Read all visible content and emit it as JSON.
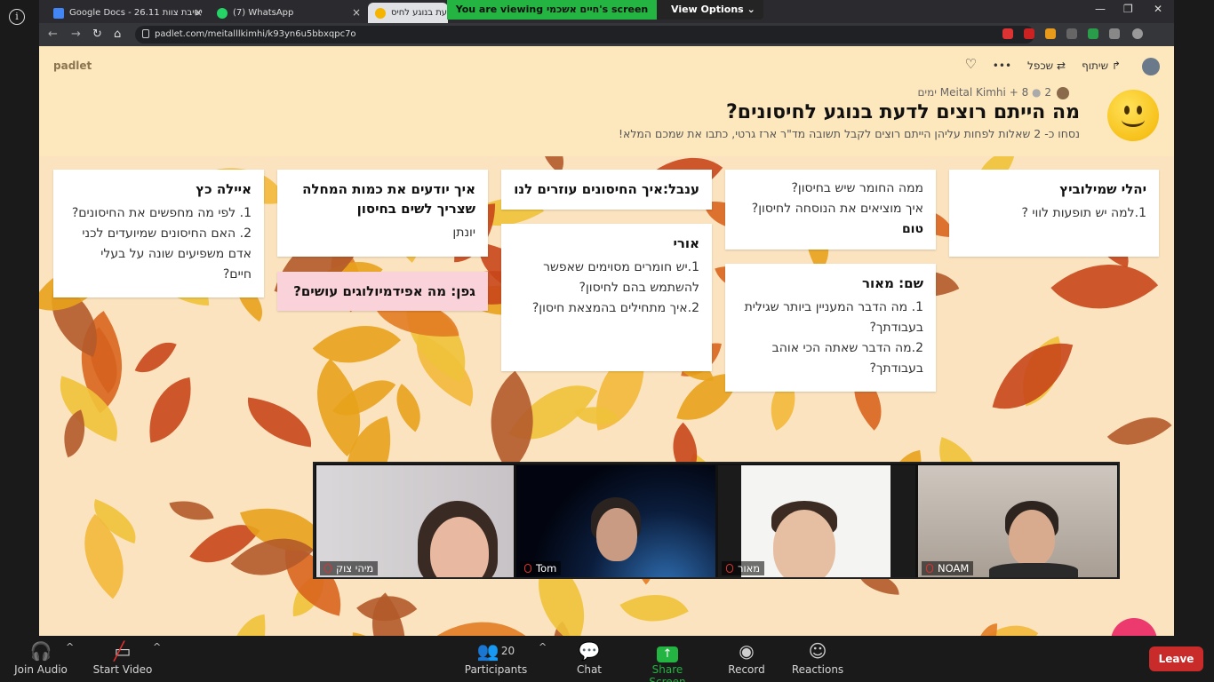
{
  "zoom": {
    "banner_text": "You are viewing חיים אשכמי's screen",
    "view_options": "View Options",
    "toolbar": [
      {
        "label": "Join Audio",
        "icon": "headphones-icon"
      },
      {
        "label": "Start Video",
        "icon": "video-off-icon"
      },
      {
        "label": "Participants",
        "icon": "participants-icon",
        "count": "20"
      },
      {
        "label": "Chat",
        "icon": "chat-icon"
      },
      {
        "label": "Share Screen",
        "icon": "share-screen-icon"
      },
      {
        "label": "Record",
        "icon": "record-icon"
      },
      {
        "label": "Reactions",
        "icon": "reactions-icon"
      }
    ],
    "leave": "Leave",
    "participants": [
      {
        "name": "מיהי צוק"
      },
      {
        "name": "Tom"
      },
      {
        "name": "מאור"
      },
      {
        "name": "NOAM"
      }
    ]
  },
  "browser": {
    "tabs": [
      {
        "title": "Google Docs - 26.11 ישיבת צוות",
        "fav_color": "#4285f4"
      },
      {
        "title": "(7) WhatsApp",
        "fav_color": "#25d366"
      },
      {
        "title": "מה הייתם רוצים לדעת בנוגע לחיס",
        "fav_color": "#f4b400"
      }
    ],
    "url": "padlet.com/meitalllkimhi/k93yn6u5bbxqpc7o",
    "tab_close": "×"
  },
  "padlet": {
    "logo": "padlet",
    "actions": {
      "share": "שיתוף",
      "remake": "שכפל",
      "more": "•••"
    },
    "meta": {
      "author": "Meital Kimhi",
      "plus_count": "+ 8",
      "age": "2 ימים"
    },
    "title": "מה הייתם רוצים לדעת בנוגע לחיסונים?",
    "description": "נסחו כ- 2 שאלות לפחות עליהן הייתם רוצים לקבל תשובה מד\"ר ארז גרטי, כתבו את שמכם המלא!",
    "posts": [
      {
        "title": "יהלי שמילוביץ",
        "lines": [
          "1.למה יש תופעות לווי ?"
        ]
      },
      {
        "title": "",
        "lines": [
          "ממה החומר שיש בחיסון?",
          "איך מוציאים את הנוסחה לחיסון?"
        ],
        "footer": "טום"
      },
      {
        "title": "שם: מאור",
        "lines": [
          "1. מה הדבר המעניין ביותר שגילית",
          "בעבודתך?",
          "2.מה הדבר שאתה הכי אוהב",
          "בעבודתך?"
        ]
      },
      {
        "title": "ענבל:איך החיסונים עוזרים לנו",
        "lines": []
      },
      {
        "title": "אורי",
        "lines": [
          "1.יש חומרים מסוימים שאפשר",
          "להשתמש בהם לחיסון?",
          "2.איך מתחילים בהמצאת חיסון?"
        ]
      },
      {
        "title": "איך יודעים את כמות המחלה שצריך לשים בחיסון",
        "lines": [
          "יונתן"
        ]
      },
      {
        "title": "גפן: מה אפידמיולוגים עושים?",
        "lines": []
      },
      {
        "title": "איילה כץ",
        "lines": [
          "1. לפי מה מחפשים את החיסונים?",
          "2. האם החיסונים שמיועדים לכני",
          "אדם משפיעים שונה על בעלי",
          "חיים?"
        ]
      }
    ]
  }
}
